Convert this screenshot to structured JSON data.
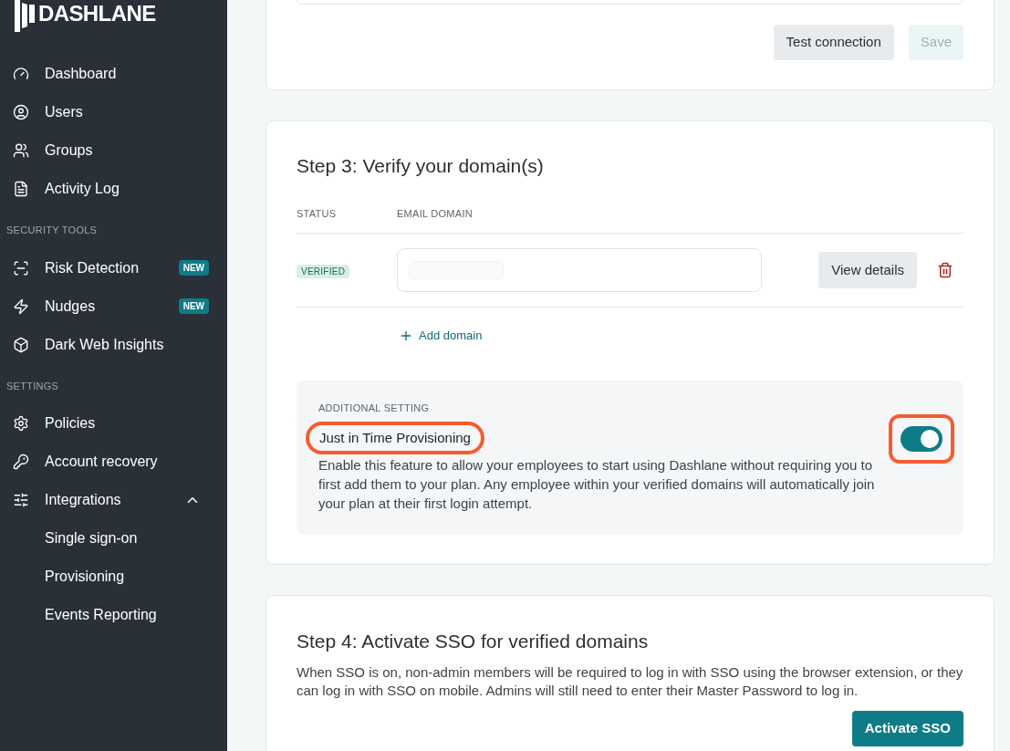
{
  "sidebar": {
    "logo": "DASHLANE",
    "sections": [
      {
        "items": [
          {
            "label": "Dashboard"
          },
          {
            "label": "Users"
          },
          {
            "label": "Groups"
          },
          {
            "label": "Activity Log"
          }
        ]
      },
      {
        "heading": "SECURITY TOOLS",
        "items": [
          {
            "label": "Risk Detection",
            "badge": "NEW"
          },
          {
            "label": "Nudges",
            "badge": "NEW"
          },
          {
            "label": "Dark Web Insights"
          }
        ]
      },
      {
        "heading": "SETTINGS",
        "items": [
          {
            "label": "Policies"
          },
          {
            "label": "Account recovery"
          },
          {
            "label": "Integrations",
            "expanded": true,
            "children": [
              {
                "label": "Single sign-on"
              },
              {
                "label": "Provisioning"
              },
              {
                "label": "Events Reporting"
              }
            ]
          }
        ]
      }
    ]
  },
  "connection_card": {
    "buttons": [
      {
        "label": "Test connection",
        "disabled": false
      },
      {
        "label": "Save",
        "disabled": true
      }
    ]
  },
  "step3": {
    "title": "Step 3: Verify your domain(s)",
    "columns": [
      "STATUS",
      "EMAIL DOMAIN"
    ],
    "rows": [
      {
        "status": "VERIFIED",
        "action": "View details"
      }
    ],
    "add_domain": "Add domain",
    "additional": {
      "heading": "ADDITIONAL SETTING",
      "title": "Just in Time Provisioning",
      "description": "Enable this feature to allow your employees to start using Dashlane without requiring you to first add them to your plan. Any employee within your verified domains will automatically join your plan at their first login attempt.",
      "on": true
    }
  },
  "step4": {
    "title": "Step 4: Activate SSO for verified domains",
    "description": "When SSO is on, non-admin members will be required to log in with SSO using the browser extension, or they can log in with SSO on mobile. Admins will still need to enter their Master Password to log in.",
    "button": "Activate SSO"
  }
}
